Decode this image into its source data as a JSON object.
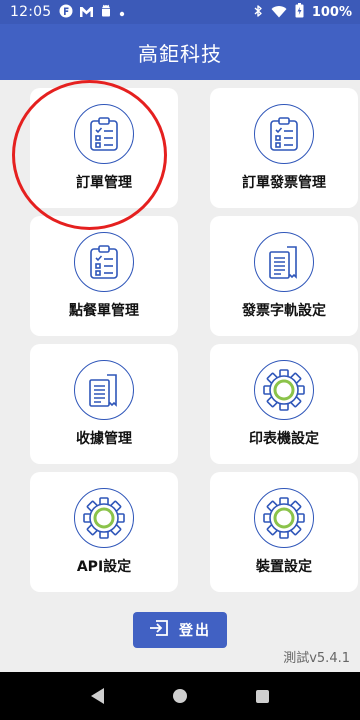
{
  "status_bar": {
    "time": "12:05",
    "notification_icons": [
      "f-app-icon",
      "gmail-icon",
      "android-icon",
      "dot-icon"
    ],
    "battery_text": "100%"
  },
  "app_bar": {
    "title": "高鉅科技"
  },
  "menu": [
    {
      "label": "訂單管理",
      "icon": "clipboard-checklist-icon"
    },
    {
      "label": "訂單發票管理",
      "icon": "clipboard-checklist-icon"
    },
    {
      "label": "點餐單管理",
      "icon": "clipboard-checklist-icon"
    },
    {
      "label": "發票字軌設定",
      "icon": "receipt-icon"
    },
    {
      "label": "收據管理",
      "icon": "receipt-icon"
    },
    {
      "label": "印表機設定",
      "icon": "gear-icon"
    },
    {
      "label": "API設定",
      "icon": "gear-icon"
    },
    {
      "label": "裝置設定",
      "icon": "gear-icon"
    }
  ],
  "logout": {
    "label": "登出",
    "icon": "logout-icon"
  },
  "version": "測試v5.4.1",
  "colors": {
    "primary": "#4161c3",
    "icon_blue": "#2f56b9",
    "icon_green": "#8bc34a",
    "highlight": "#e5201f"
  }
}
